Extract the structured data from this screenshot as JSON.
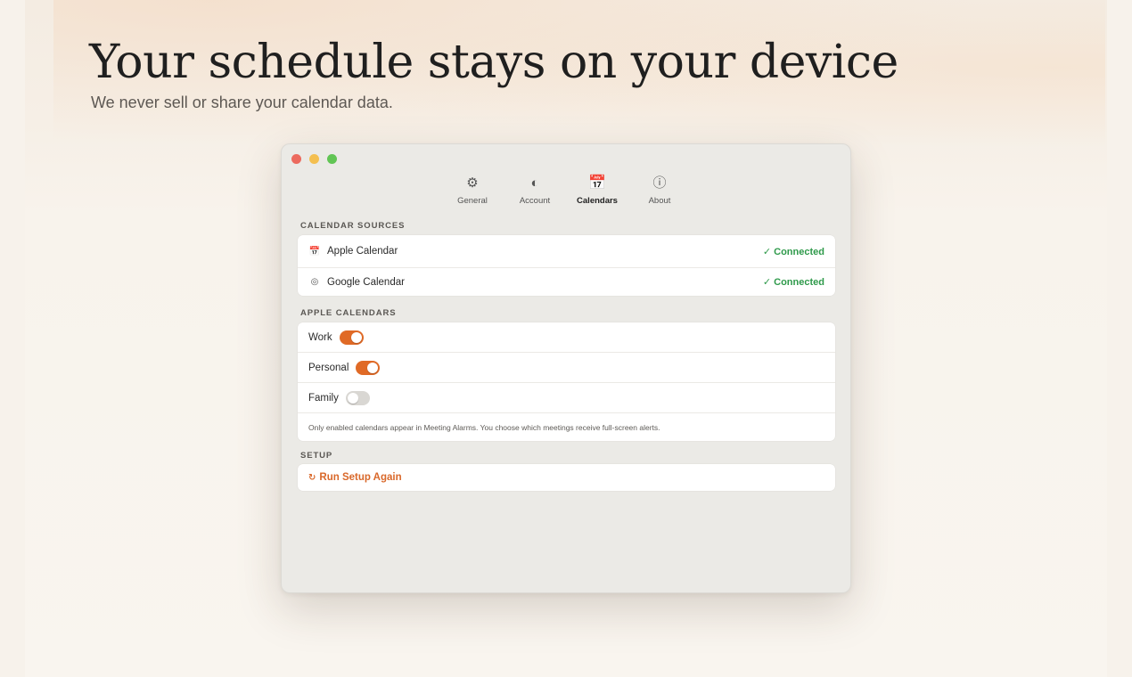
{
  "hero": {
    "title": "Your schedule stays on your device",
    "subtitle": "We never sell or share your calendar data."
  },
  "window": {
    "tabs": [
      {
        "label": "General",
        "icon": "gear-icon",
        "glyph": "⚙"
      },
      {
        "label": "Account",
        "icon": "half-circle-icon",
        "glyph": "◐"
      },
      {
        "label": "Calendars",
        "icon": "calendar-icon",
        "glyph": "📅",
        "active": true
      },
      {
        "label": "About",
        "icon": "info-icon",
        "glyph": "ⓘ"
      }
    ],
    "sources": {
      "title": "CALENDAR SOURCES",
      "items": [
        {
          "name": "Apple Calendar",
          "icon": "calendar-icon",
          "glyph": "📅",
          "status": "✓ Connected"
        },
        {
          "name": "Google Calendar",
          "icon": "target-icon",
          "glyph": "◎",
          "status": "✓ Connected"
        }
      ]
    },
    "apple_calendars": {
      "title": "APPLE CALENDARS",
      "items": [
        {
          "name": "Work",
          "enabled": true
        },
        {
          "name": "Personal",
          "enabled": true
        },
        {
          "name": "Family",
          "enabled": false
        }
      ],
      "note": "Only enabled calendars appear in Meeting Alarms. You choose which meetings receive full-screen alerts."
    },
    "setup": {
      "title": "SETUP",
      "button_icon": "↻",
      "button_label": "Run Setup Again"
    }
  },
  "colors": {
    "accent": "#e06a26",
    "connected": "#2f9a4b",
    "window_bg": "#ebeae6"
  }
}
